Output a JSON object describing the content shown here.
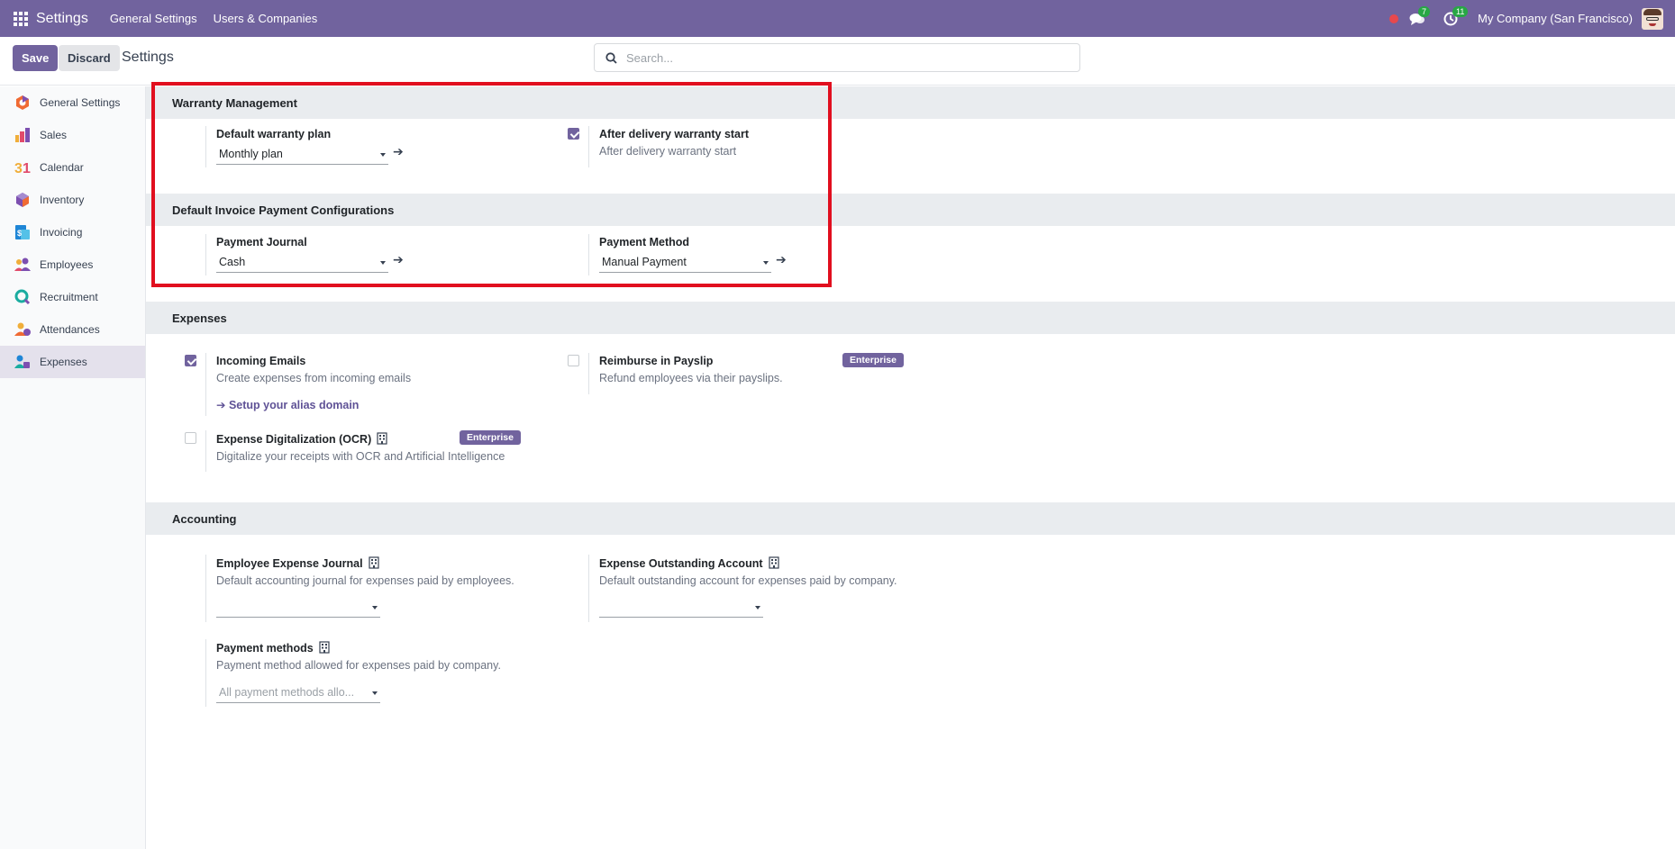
{
  "navbar": {
    "app_title": "Settings",
    "menu": [
      "General Settings",
      "Users & Companies"
    ],
    "messages_count": "7",
    "activities_count": "11",
    "company": "My Company (San Francisco)"
  },
  "control": {
    "save_label": "Save",
    "discard_label": "Discard",
    "title": "Settings",
    "search_placeholder": "Search..."
  },
  "sidebar": {
    "items": [
      {
        "label": "General Settings",
        "icon": "general-settings-icon"
      },
      {
        "label": "Sales",
        "icon": "sales-icon"
      },
      {
        "label": "Calendar",
        "icon": "calendar-icon"
      },
      {
        "label": "Inventory",
        "icon": "inventory-icon"
      },
      {
        "label": "Invoicing",
        "icon": "invoicing-icon"
      },
      {
        "label": "Employees",
        "icon": "employees-icon"
      },
      {
        "label": "Recruitment",
        "icon": "recruitment-icon"
      },
      {
        "label": "Attendances",
        "icon": "attendances-icon"
      },
      {
        "label": "Expenses",
        "icon": "expenses-icon",
        "active": true
      }
    ]
  },
  "warranty": {
    "header": "Warranty Management",
    "plan_label": "Default warranty plan",
    "plan_value": "Monthly plan",
    "after_delivery_label": "After delivery warranty start",
    "after_delivery_desc": "After delivery warranty start",
    "after_delivery_checked": true
  },
  "invoice_payment": {
    "header": "Default Invoice Payment Configurations",
    "journal_label": "Payment Journal",
    "journal_value": "Cash",
    "method_label": "Payment Method",
    "method_value": "Manual Payment"
  },
  "expenses": {
    "header": "Expenses",
    "incoming_label": "Incoming Emails",
    "incoming_desc": "Create expenses from incoming emails",
    "incoming_checked": true,
    "alias_link": "➔ Setup your alias domain",
    "reimburse_label": "Reimburse in Payslip",
    "reimburse_desc": "Refund employees via their payslips.",
    "reimburse_checked": false,
    "ocr_label": "Expense Digitalization (OCR)",
    "ocr_desc": "Digitalize your receipts with OCR and Artificial Intelligence",
    "ocr_checked": false,
    "enterprise_badge": "Enterprise"
  },
  "accounting": {
    "header": "Accounting",
    "journal_label": "Employee Expense Journal",
    "journal_desc": "Default accounting journal for expenses paid by employees.",
    "outstanding_label": "Expense Outstanding Account",
    "outstanding_desc": "Default outstanding account for expenses paid by company.",
    "methods_label": "Payment methods",
    "methods_desc": "Payment method allowed for expenses paid by company.",
    "methods_placeholder": "All payment methods allo..."
  },
  "colors": {
    "brand": "#71639e",
    "highlight": "#e10f1f",
    "badge_green": "#28a745"
  }
}
